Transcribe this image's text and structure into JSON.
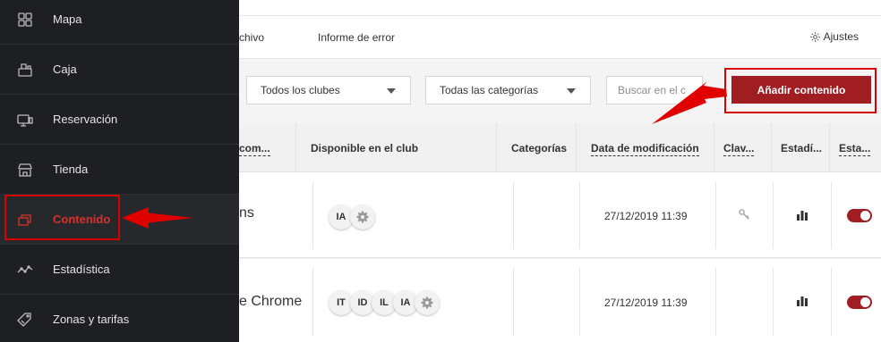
{
  "sidebar": {
    "items": [
      {
        "label": "Mapa",
        "icon": "map-icon"
      },
      {
        "label": "Caja",
        "icon": "cash-register-icon"
      },
      {
        "label": "Reservación",
        "icon": "reservation-icon"
      },
      {
        "label": "Tienda",
        "icon": "store-icon"
      },
      {
        "label": "Contenido",
        "icon": "content-icon",
        "active": true
      },
      {
        "label": "Estadística",
        "icon": "statistics-icon"
      },
      {
        "label": "Zonas y tarifas",
        "icon": "tariff-tag-icon"
      }
    ]
  },
  "tabs": {
    "archive_partial": "chivo",
    "error_report": "Informe de error",
    "settings": "Ajustes"
  },
  "filters": {
    "clubs": "Todos los clubes",
    "categories": "Todas las categorías",
    "search_placeholder": "Buscar en el c",
    "add_button": "Añadir contenido"
  },
  "table": {
    "headers": {
      "name_partial": "com...",
      "available_in_club": "Disponible en el club",
      "categories": "Categorías",
      "modified_date": "Data de modificación",
      "keys": "Clav...",
      "statistics": "Estadí...",
      "status": "Esta..."
    },
    "rows": [
      {
        "name_partial": "ns",
        "clubs": [
          "IA"
        ],
        "date": "27/12/2019 11:39"
      },
      {
        "name_partial": "e Chrome",
        "clubs": [
          "IT",
          "ID",
          "IL",
          "IA"
        ],
        "date": "27/12/2019 11:39"
      }
    ]
  },
  "colors": {
    "sidebar_bg": "#1d1f22",
    "accent": "#a01d21",
    "active_text": "#d9322c",
    "annotation": "#d80000"
  }
}
